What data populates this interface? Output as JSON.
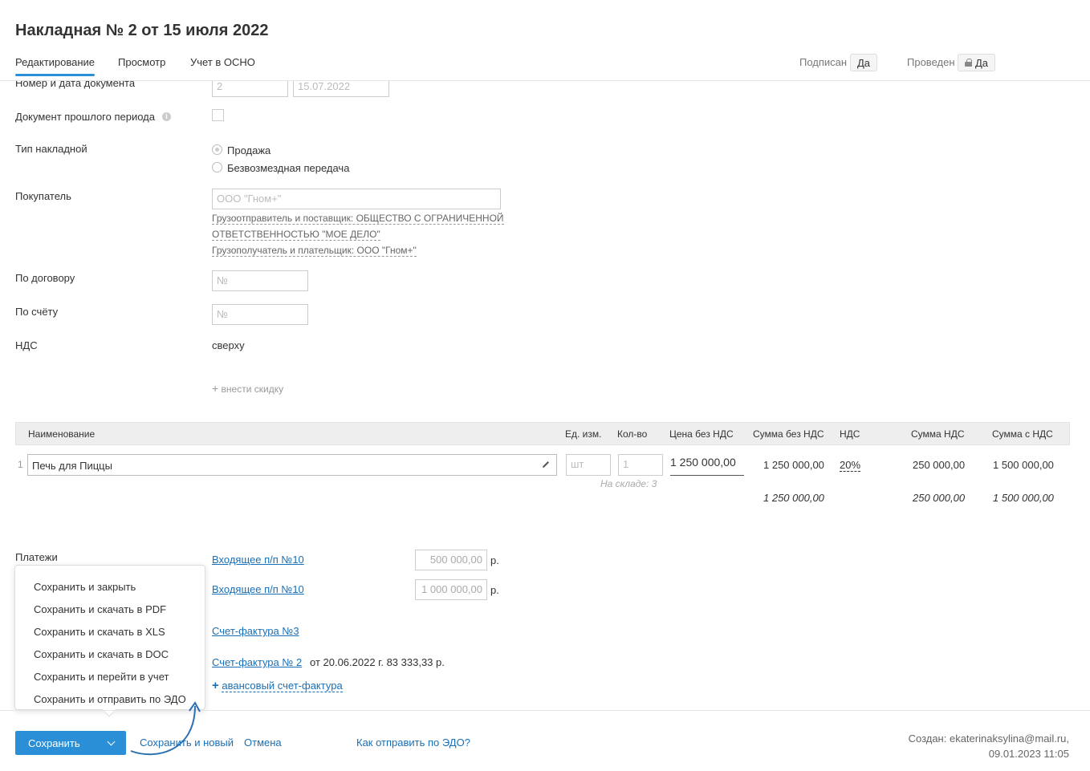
{
  "header": {
    "title": "Накладная № 2 от 15 июля 2022",
    "tabs": [
      "Редактирование",
      "Просмотр",
      "Учет в ОСНО"
    ],
    "signed_label": "Подписан",
    "signed_value": "Да",
    "posted_label": "Проведен",
    "posted_value": "Да"
  },
  "form": {
    "number_date_label": "Номер и дата документа",
    "number_value": "2",
    "date_value": "15.07.2022",
    "past_period_label": "Документ прошлого периода",
    "invoice_type_label": "Тип накладной",
    "type_options": [
      "Продажа",
      "Безвозмездная передача"
    ],
    "buyer_label": "Покупатель",
    "buyer_value": "ООО \"Гном+\"",
    "shipper_line1": "Грузоотправитель и поставщик: ОБЩЕСТВО С ОГРАНИЧЕННОЙ",
    "shipper_line2": "ОТВЕТСТВЕННОСТЬЮ \"МОЕ ДЕЛО\"",
    "consignee_line": "Грузополучатель и плательщик: ООО \"Гном+\"",
    "contract_label": "По договору",
    "contract_placeholder": "№",
    "account_label": "По счёту",
    "account_placeholder": "№",
    "vat_label": "НДС",
    "vat_value": "сверху",
    "discount_link": "внести скидку"
  },
  "table": {
    "headers": [
      "Наименование",
      "Ед. изм.",
      "Кол-во",
      "Цена без НДС",
      "Сумма без НДС",
      "НДС",
      "Сумма НДС",
      "Сумма с НДС"
    ],
    "row": {
      "index": "1",
      "name": "Печь для Пиццы",
      "unit_placeholder": "шт",
      "qty_placeholder": "1",
      "stock_note": "На складе: 3",
      "price": "1 250 000,00",
      "sum_no_vat": "1 250 000,00",
      "vat_rate": "20%",
      "vat_sum": "250 000,00",
      "sum_with_vat": "1 500 000,00"
    },
    "totals": {
      "sum_no_vat": "1 250 000,00",
      "vat_sum": "250 000,00",
      "sum_with_vat": "1 500 000,00"
    }
  },
  "payments": {
    "label": "Платежи",
    "items": [
      {
        "link": "Входящее п/п №10",
        "amount": "500 000,00",
        "currency": "р."
      },
      {
        "link": "Входящее п/п №10",
        "amount": "1 000 000,00",
        "currency": "р."
      }
    ],
    "invoice_link": "Счет-фактура №3",
    "invoice2_link": "Счет-фактура № 2",
    "invoice2_text": "от 20.06.2022 г. 83 333,33 р.",
    "advance_link": "авансовый счет-фактура"
  },
  "dropdown": {
    "items": [
      "Сохранить и закрыть",
      "Сохранить и скачать в PDF",
      "Сохранить и скачать в XLS",
      "Сохранить и скачать в DOC",
      "Сохранить и перейти в учет",
      "Сохранить и отправить по ЭДО"
    ]
  },
  "footer": {
    "save_label": "Сохранить",
    "save_new_label": "Сохранить и новый",
    "cancel_label": "Отмена",
    "edo_link": "Как отправить по ЭДО?",
    "created_by": "Создан: ekaterinaksylina@mail.ru,",
    "created_at": "09.01.2023 11:05"
  },
  "colors": {
    "accent": "#2a8fd6",
    "link": "#1a6fb7"
  }
}
